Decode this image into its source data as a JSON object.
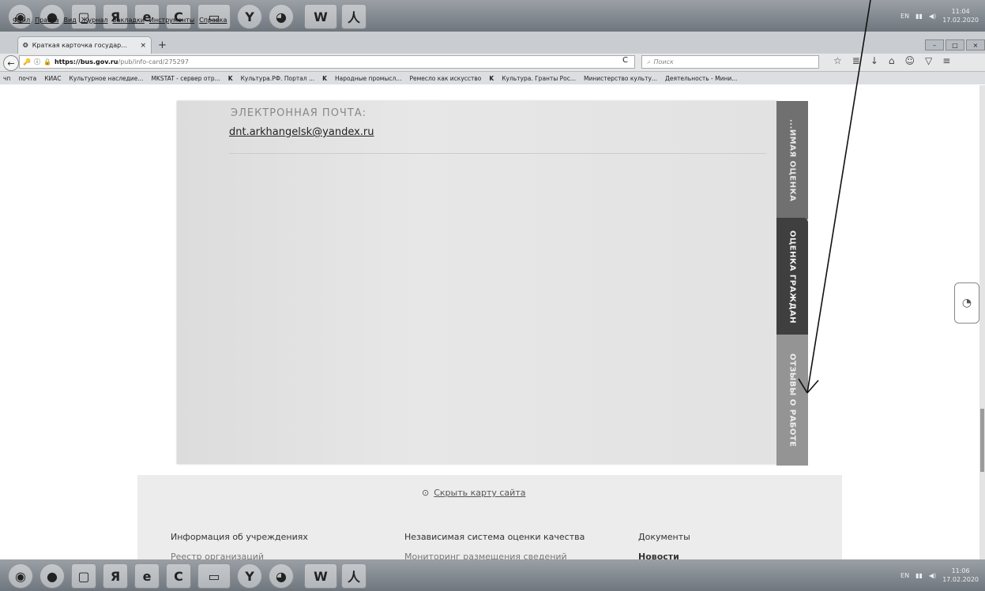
{
  "taskbar_top": {
    "apps": [
      "start-orb-icon",
      "chrome-like-icon",
      "media-icon",
      "yandex-browser-icon",
      "ie-icon",
      "ccleaner-icon",
      "folder-icon",
      "yandex-icon",
      "firefox-icon",
      "word-icon",
      "acrobat-icon"
    ],
    "ya_label": "Я",
    "word_label": "W",
    "lang": "EN",
    "clock_time": "11:04",
    "clock_date": "17.02.2020"
  },
  "menubar": [
    "Файл",
    "Правка",
    "Вид",
    "Журнал",
    "Закладки",
    "Инструменты",
    "Справка"
  ],
  "tab": {
    "title": "Краткая карточка государ...",
    "close": "×",
    "new_tab": "+"
  },
  "navbar": {
    "url_host": "https://bus.gov.ru",
    "url_path": "/pub/info-card/275297",
    "search_placeholder": "Поиск"
  },
  "bookmarks": [
    "чп",
    "почта",
    "КИАС",
    "Культурное наследие...",
    "MKSTAT - сервер отр...",
    "Культура.РФ. Портал ...",
    "Народные промысл...",
    "Ремесло как искусство",
    "Культура. Гранты Рос...",
    "Министерство культу...",
    "Деятельность - Мини..."
  ],
  "card": {
    "label": "ЭЛЕКТРОННАЯ ПОЧТА:",
    "email": "dnt.arkhangelsk@yandex.ru"
  },
  "vertical_tabs": [
    "...ИМАЯ ОЦЕНКА",
    "ОЦЕНКА ГРАЖДАН",
    "ОТЗЫВЫ О РАБОТЕ"
  ],
  "footer": {
    "hide_map": "Скрыть карту сайта",
    "columns": [
      {
        "heading": "Информация об учреждениях",
        "item": "Реестр организаций"
      },
      {
        "heading": "Независимая система оценки качества",
        "item": "Мониторинг размещения сведений"
      },
      {
        "heading": "Документы",
        "item": "Новости"
      }
    ]
  },
  "taskbar_bottom": {
    "lang": "EN",
    "clock_time": "11:06",
    "clock_date": "17.02.2020"
  }
}
